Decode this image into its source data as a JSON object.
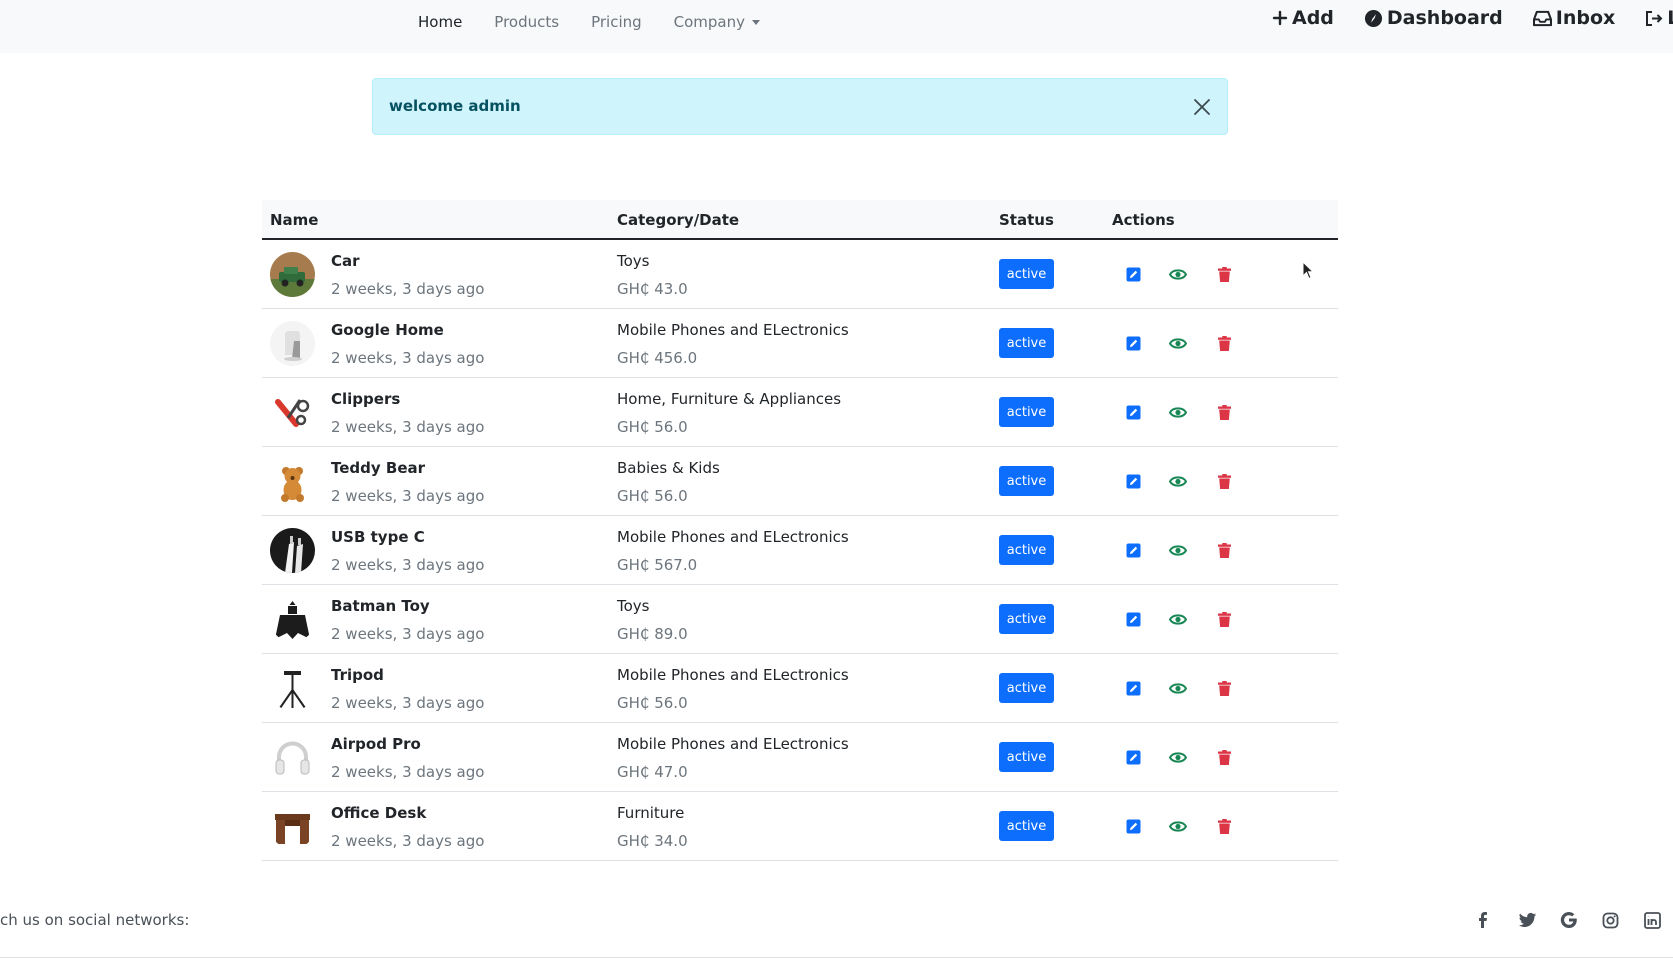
{
  "nav": {
    "links": [
      "Home",
      "Products",
      "Pricing",
      "Company"
    ],
    "actions": [
      "Add",
      "Dashboard",
      "Inbox",
      "Lo"
    ]
  },
  "alert": {
    "text": "welcome admin"
  },
  "table": {
    "headers": [
      "Name",
      "Category/Date",
      "Status",
      "Actions"
    ],
    "rows": [
      {
        "name": "Car",
        "date": "2 weeks, 3 days ago",
        "category": "Toys",
        "price": "GH₵ 43.0",
        "status": "active",
        "image": "car"
      },
      {
        "name": "Google Home",
        "date": "2 weeks, 3 days ago",
        "category": "Mobile Phones and ELectronics",
        "price": "GH₵ 456.0",
        "status": "active",
        "image": "google-home"
      },
      {
        "name": "Clippers",
        "date": "2 weeks, 3 days ago",
        "category": "Home, Furniture & Appliances",
        "price": "GH₵ 56.0",
        "status": "active",
        "image": "clippers"
      },
      {
        "name": "Teddy Bear",
        "date": "2 weeks, 3 days ago",
        "category": "Babies & Kids",
        "price": "GH₵ 56.0",
        "status": "active",
        "image": "teddy-bear"
      },
      {
        "name": "USB type C",
        "date": "2 weeks, 3 days ago",
        "category": "Mobile Phones and ELectronics",
        "price": "GH₵ 567.0",
        "status": "active",
        "image": "usb"
      },
      {
        "name": "Batman Toy",
        "date": "2 weeks, 3 days ago",
        "category": "Toys",
        "price": "GH₵ 89.0",
        "status": "active",
        "image": "batman"
      },
      {
        "name": "Tripod",
        "date": "2 weeks, 3 days ago",
        "category": "Mobile Phones and ELectronics",
        "price": "GH₵ 56.0",
        "status": "active",
        "image": "tripod"
      },
      {
        "name": "Airpod Pro",
        "date": "2 weeks, 3 days ago",
        "category": "Mobile Phones and ELectronics",
        "price": "GH₵ 47.0",
        "status": "active",
        "image": "headphones"
      },
      {
        "name": "Office Desk",
        "date": "2 weeks, 3 days ago",
        "category": "Furniture",
        "price": "GH₵ 34.0",
        "status": "active",
        "image": "desk"
      }
    ]
  },
  "footer": {
    "text": "ch us on social networks:",
    "socials": [
      "facebook-icon",
      "twitter-icon",
      "google-icon",
      "instagram-icon",
      "linkedin-icon"
    ]
  },
  "colors": {
    "primary": "#0d6efd",
    "view": "#198754",
    "danger": "#dc3545",
    "alert_bg": "#cff4fc",
    "alert_text": "#055160"
  }
}
